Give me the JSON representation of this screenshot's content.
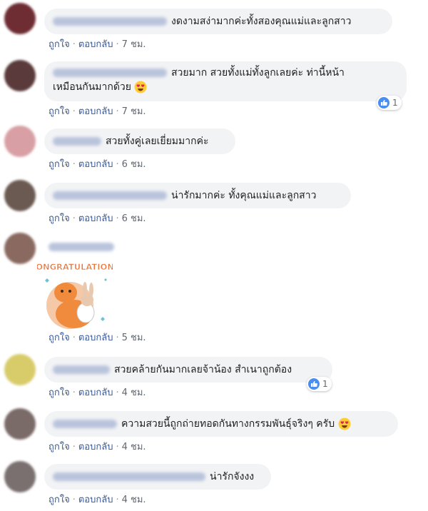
{
  "colors": {
    "bubble": "#f2f3f5",
    "link": "#385898",
    "meta": "#606770",
    "like": "#4a8ef0"
  },
  "comments": [
    {
      "text": "งดงามสง่ามากค่ะทั้งสองคุณแม่และลูกสาว",
      "like_label": "ถูกใจ",
      "reply_label": "ตอบกลับ",
      "time": "7 ชม."
    },
    {
      "text_line1": "สวยมาก สวยทั้งแม่ทั้งลูกเลยค่ะ ท่านี้หน้า",
      "text_line2": "เหมือนกันมากด้วย",
      "emoji": "heart-eyes-emoji",
      "like_label": "ถูกใจ",
      "reply_label": "ตอบกลับ",
      "time": "7 ชม.",
      "reaction_count": "1"
    },
    {
      "text": "สวยทั้งคู่เลยเยี่ยมมากค่ะ",
      "like_label": "ถูกใจ",
      "reply_label": "ตอบกลับ",
      "time": "6 ชม."
    },
    {
      "text": "น่ารักมากค่ะ ทั้งคุณแม่และลูกสาว",
      "like_label": "ถูกใจ",
      "reply_label": "ตอบกลับ",
      "time": "6 ชม."
    },
    {
      "sticker_text": "CONGRATULATIONS",
      "like_label": "ถูกใจ",
      "reply_label": "ตอบกลับ",
      "time": "5 ชม."
    },
    {
      "text": "สวยคล้ายกันมากเลยจ้าน้อง สำเนาถูกต้อง",
      "like_label": "ถูกใจ",
      "reply_label": "ตอบกลับ",
      "time": "4 ชม.",
      "reaction_count": "1"
    },
    {
      "text": "ความสวยนี้ถูกถ่ายทอดกันทางกรรมพันธุ์จริงๆ ครับ",
      "emoji": "heart-eyes-emoji",
      "like_label": "ถูกใจ",
      "reply_label": "ตอบกลับ",
      "time": "4 ชม."
    },
    {
      "text": "น่ารักจังงง",
      "like_label": "ถูกใจ",
      "reply_label": "ตอบกลับ",
      "time": "4 ชม."
    }
  ]
}
